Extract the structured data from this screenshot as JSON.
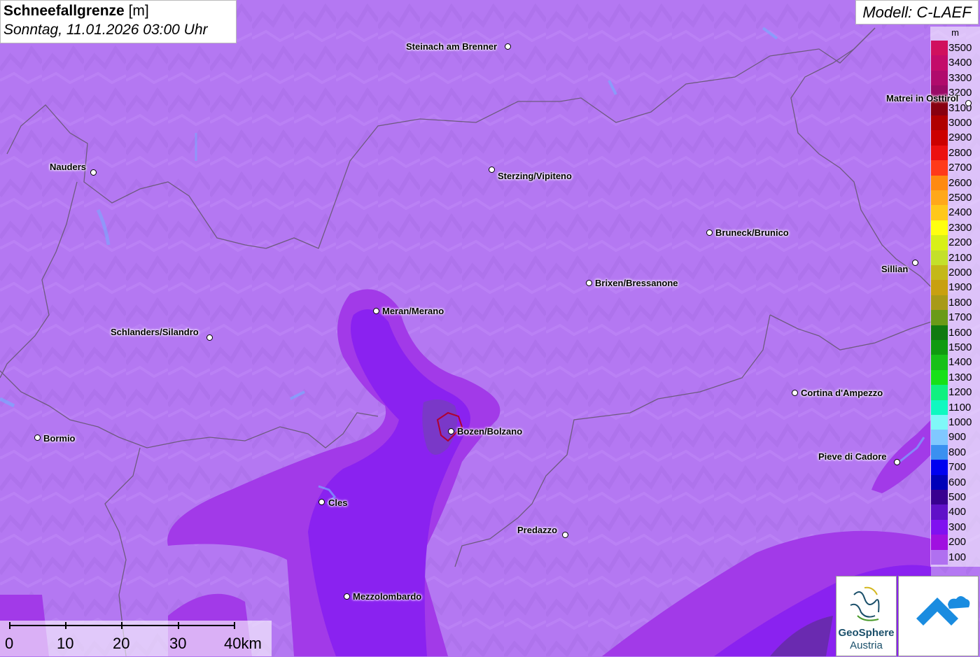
{
  "title": {
    "main": "Schneefallgrenze",
    "unit": "[m]",
    "subtitle": "Sonntag, 11.01.2026 03:00 Uhr"
  },
  "model": "Modell: C-LAEF",
  "legend": {
    "unit": "m",
    "entries": [
      {
        "label": "3500",
        "color": "#d0105e"
      },
      {
        "label": "3400",
        "color": "#c30b6a"
      },
      {
        "label": "3300",
        "color": "#b00a6c"
      },
      {
        "label": "3200",
        "color": "#9a0a66"
      },
      {
        "label": "3100",
        "color": "#880010"
      },
      {
        "label": "3000",
        "color": "#b00000"
      },
      {
        "label": "2900",
        "color": "#cc0000"
      },
      {
        "label": "2800",
        "color": "#ec1010"
      },
      {
        "label": "2700",
        "color": "#ff3a1a"
      },
      {
        "label": "2600",
        "color": "#ff8a10"
      },
      {
        "label": "2500",
        "color": "#ffa81a"
      },
      {
        "label": "2400",
        "color": "#ffc81a"
      },
      {
        "label": "2300",
        "color": "#ffff10"
      },
      {
        "label": "2200",
        "color": "#d8f018"
      },
      {
        "label": "2100",
        "color": "#c4e02a"
      },
      {
        "label": "2000",
        "color": "#c4b818"
      },
      {
        "label": "1900",
        "color": "#c8a010"
      },
      {
        "label": "1800",
        "color": "#a89a18"
      },
      {
        "label": "1700",
        "color": "#6a9a18"
      },
      {
        "label": "1600",
        "color": "#107a10"
      },
      {
        "label": "1500",
        "color": "#109a10"
      },
      {
        "label": "1400",
        "color": "#18c018"
      },
      {
        "label": "1300",
        "color": "#18e018"
      },
      {
        "label": "1200",
        "color": "#10f080"
      },
      {
        "label": "1100",
        "color": "#10f8c0"
      },
      {
        "label": "1000",
        "color": "#80f8f8"
      },
      {
        "label": "900",
        "color": "#80c8ff"
      },
      {
        "label": "800",
        "color": "#3a90f0"
      },
      {
        "label": "700",
        "color": "#0000f0"
      },
      {
        "label": "600",
        "color": "#0000b8"
      },
      {
        "label": "500",
        "color": "#380090"
      },
      {
        "label": "400",
        "color": "#6010c8"
      },
      {
        "label": "300",
        "color": "#8010f0"
      },
      {
        "label": "200",
        "color": "#a010e0"
      },
      {
        "label": "100",
        "color": "#b070f0"
      }
    ]
  },
  "places": [
    {
      "name": "Steinach am Brenner"
    },
    {
      "name": "Matrei in Osttirol"
    },
    {
      "name": "Nauders"
    },
    {
      "name": "Sterzing/Vipiteno"
    },
    {
      "name": "Bruneck/Brunico"
    },
    {
      "name": "Sillian"
    },
    {
      "name": "Brixen/Bressanone"
    },
    {
      "name": "Meran/Merano"
    },
    {
      "name": "Schlanders/Silandro"
    },
    {
      "name": "Cortina d'Ampezzo"
    },
    {
      "name": "Bozen/Bolzano"
    },
    {
      "name": "Bormio"
    },
    {
      "name": "Pieve di Cadore"
    },
    {
      "name": "Cles"
    },
    {
      "name": "Predazzo"
    },
    {
      "name": "Mezzolombardo"
    }
  ],
  "scale": {
    "labels": [
      "0",
      "10",
      "20",
      "30",
      "40km"
    ]
  },
  "logos": {
    "geosphere": [
      "GeoSphere",
      "Austria"
    ]
  }
}
